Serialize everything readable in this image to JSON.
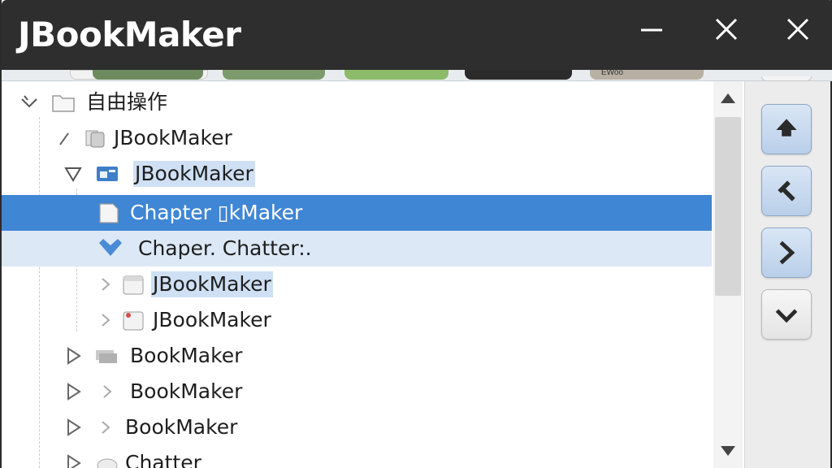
{
  "window": {
    "title": "JBookMaker",
    "controls": [
      "minimize",
      "close",
      "close"
    ]
  },
  "thumbnail_strip": {
    "partial_text": "EWoo"
  },
  "tree": {
    "rows": [
      {
        "label": "自由操作",
        "toggle": "expanded",
        "icon": "folder-icon",
        "state": "normal"
      },
      {
        "label": "JBookMaker",
        "toggle": "line",
        "icon": "book-stack-icon",
        "state": "normal"
      },
      {
        "label": "JBookMaker",
        "toggle": "expanded",
        "icon": "blue-window-icon",
        "state": "highlight"
      },
      {
        "label": "Chapter ▯kMaker",
        "toggle": "none",
        "icon": "page-icon",
        "state": "selected"
      },
      {
        "label": "Chaper. Chatter:.",
        "toggle": "none",
        "icon": "heart-icon",
        "state": "hover"
      },
      {
        "label": "JBookMaker",
        "toggle": "collapsed",
        "icon": "page-icon",
        "state": "highlight"
      },
      {
        "label": "JBookMaker",
        "toggle": "collapsed",
        "icon": "page-red-icon",
        "state": "normal"
      },
      {
        "label": "BookMaker",
        "toggle": "collapsed",
        "icon": "stack-icon",
        "state": "normal"
      },
      {
        "label": "BookMaker",
        "toggle": "collapsed",
        "icon": "chevron-right-icon",
        "state": "normal"
      },
      {
        "label": "BookMaker",
        "toggle": "collapsed",
        "icon": "chevron-right-icon",
        "state": "normal"
      },
      {
        "label": "Chatter",
        "toggle": "collapsed",
        "icon": "tag-icon",
        "state": "normal"
      }
    ]
  },
  "side_buttons": [
    {
      "name": "move-top-button",
      "icon": "arrow-up-icon"
    },
    {
      "name": "move-prev-button",
      "icon": "arrow-up-left-icon"
    },
    {
      "name": "move-next-button",
      "icon": "chevron-right-icon"
    },
    {
      "name": "move-down-button",
      "icon": "chevron-down-icon"
    }
  ],
  "colors": {
    "titlebar": "#2e2e2e",
    "selection": "#3f86d4",
    "hover": "#dce8f6",
    "highlight": "#cfe0f4"
  }
}
